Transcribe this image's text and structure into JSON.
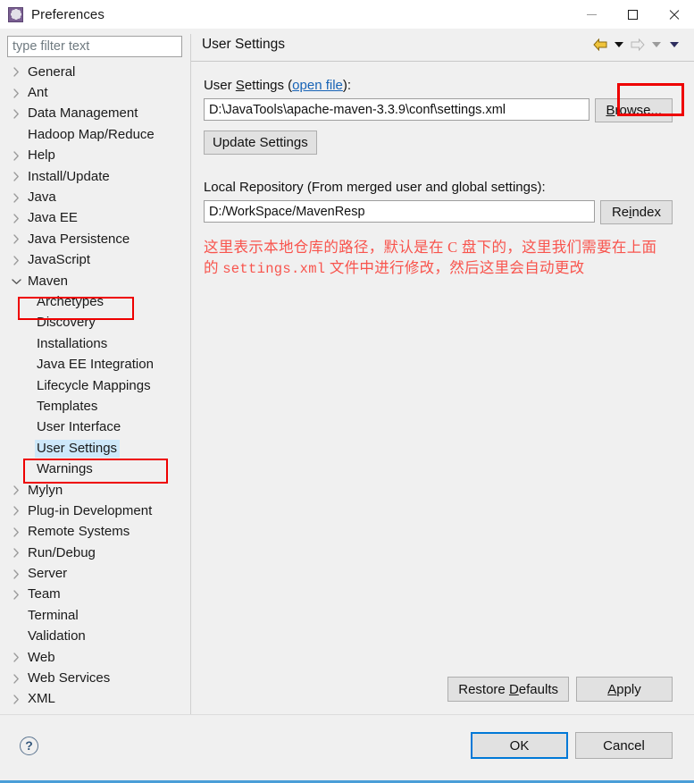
{
  "window": {
    "title": "Preferences",
    "icon": "gear-icon",
    "controls": {
      "minimize": "minimize-icon",
      "maximize": "maximize-icon",
      "close": "close-icon"
    }
  },
  "sidebar": {
    "filter_placeholder": "type filter text",
    "filter_value": "",
    "items": [
      {
        "label": "General",
        "depth": 1,
        "arrow": "collapsed"
      },
      {
        "label": "Ant",
        "depth": 1,
        "arrow": "collapsed"
      },
      {
        "label": "Data Management",
        "depth": 1,
        "arrow": "collapsed"
      },
      {
        "label": "Hadoop Map/Reduce",
        "depth": 1,
        "arrow": "none"
      },
      {
        "label": "Help",
        "depth": 1,
        "arrow": "collapsed"
      },
      {
        "label": "Install/Update",
        "depth": 1,
        "arrow": "collapsed"
      },
      {
        "label": "Java",
        "depth": 1,
        "arrow": "collapsed"
      },
      {
        "label": "Java EE",
        "depth": 1,
        "arrow": "collapsed"
      },
      {
        "label": "Java Persistence",
        "depth": 1,
        "arrow": "collapsed"
      },
      {
        "label": "JavaScript",
        "depth": 1,
        "arrow": "collapsed"
      },
      {
        "label": "Maven",
        "depth": 1,
        "arrow": "expanded",
        "highlight_box": true
      },
      {
        "label": "Archetypes",
        "depth": 2,
        "arrow": "none"
      },
      {
        "label": "Discovery",
        "depth": 2,
        "arrow": "none"
      },
      {
        "label": "Installations",
        "depth": 2,
        "arrow": "none"
      },
      {
        "label": "Java EE Integration",
        "depth": 2,
        "arrow": "none"
      },
      {
        "label": "Lifecycle Mappings",
        "depth": 2,
        "arrow": "none"
      },
      {
        "label": "Templates",
        "depth": 2,
        "arrow": "none"
      },
      {
        "label": "User Interface",
        "depth": 2,
        "arrow": "none"
      },
      {
        "label": "User Settings",
        "depth": 2,
        "arrow": "none",
        "selected": true,
        "highlight_box": true
      },
      {
        "label": "Warnings",
        "depth": 2,
        "arrow": "none"
      },
      {
        "label": "Mylyn",
        "depth": 1,
        "arrow": "collapsed"
      },
      {
        "label": "Plug-in Development",
        "depth": 1,
        "arrow": "collapsed"
      },
      {
        "label": "Remote Systems",
        "depth": 1,
        "arrow": "collapsed"
      },
      {
        "label": "Run/Debug",
        "depth": 1,
        "arrow": "collapsed"
      },
      {
        "label": "Server",
        "depth": 1,
        "arrow": "collapsed"
      },
      {
        "label": "Team",
        "depth": 1,
        "arrow": "collapsed"
      },
      {
        "label": "Terminal",
        "depth": 1,
        "arrow": "none"
      },
      {
        "label": "Validation",
        "depth": 1,
        "arrow": "none"
      },
      {
        "label": "Web",
        "depth": 1,
        "arrow": "collapsed"
      },
      {
        "label": "Web Services",
        "depth": 1,
        "arrow": "collapsed"
      },
      {
        "label": "XML",
        "depth": 1,
        "arrow": "collapsed"
      }
    ]
  },
  "page": {
    "title": "User Settings",
    "nav": {
      "back": "back-arrow-icon",
      "back_dropdown": "chevron-down-icon",
      "forward": "forward-arrow-icon",
      "forward_dropdown": "chevron-down-icon",
      "menu_dropdown": "chevron-down-icon"
    },
    "user_settings": {
      "label_before": "User ",
      "label_mnemonic": "S",
      "label_after": "ettings (",
      "link_text": "open file",
      "label_end": "):",
      "value": "D:\\JavaTools\\apache-maven-3.3.9\\conf\\settings.xml",
      "browse_mnemonic": "B",
      "browse_rest": "rowse...",
      "update_label": "Update Settings"
    },
    "local_repository": {
      "label": "Local Repository (From merged user and global settings):",
      "value": "D:/WorkSpace/MavenResp",
      "reindex_before": "Re",
      "reindex_mnemonic": "i",
      "reindex_after": "ndex"
    },
    "annotation": {
      "line1": "这里表示本地仓库的路径，默认是在 C 盘下的，这里我们需",
      "line2_a": "要在上面的 ",
      "line2_mono": "settings.xml",
      "line2_b": " 文件中进行修改，然后这里会自",
      "line3": "动更改"
    },
    "buttons": {
      "restore_before": "Restore ",
      "restore_mnemonic": "D",
      "restore_after": "efaults",
      "apply_mnemonic": "A",
      "apply_after": "pply"
    }
  },
  "footer": {
    "help": "?",
    "ok": "OK",
    "cancel": "Cancel"
  },
  "colors": {
    "accent": "#0078d7",
    "annotation_red": "#f8544d",
    "highlight_box": "#ee0000",
    "selection": "#cde8fa",
    "link": "#1763b6",
    "bottom_accent": "#4a9ed8"
  }
}
